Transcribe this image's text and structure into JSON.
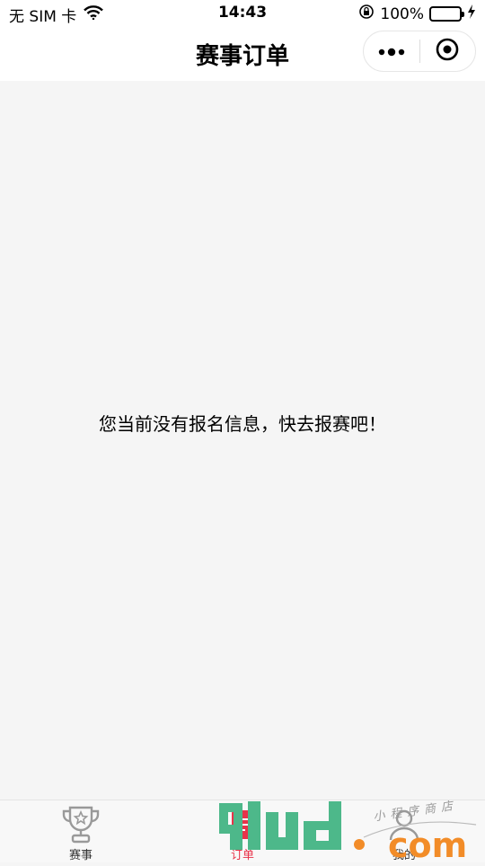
{
  "status_bar": {
    "carrier": "无 SIM 卡",
    "time": "14:43",
    "battery": "100%",
    "battery_level": 1.0
  },
  "nav_bar": {
    "title": "赛事订单"
  },
  "content": {
    "empty_message": "您当前没有报名信息，快去报赛吧！"
  },
  "tab_bar": {
    "tabs": [
      {
        "label": "赛事",
        "icon": "trophy-icon",
        "active": false
      },
      {
        "label": "订单",
        "icon": "order-icon",
        "active": true
      },
      {
        "label": "我的",
        "icon": "user-icon",
        "active": false
      }
    ]
  },
  "watermark": {
    "logo": "9lud.com",
    "tagline": "小程序商店"
  },
  "colors": {
    "active_tab": "#e8334a",
    "background": "#f5f5f5",
    "battery": "#4cd964",
    "watermark_green": "#4db88a",
    "watermark_orange": "#f28c28"
  }
}
